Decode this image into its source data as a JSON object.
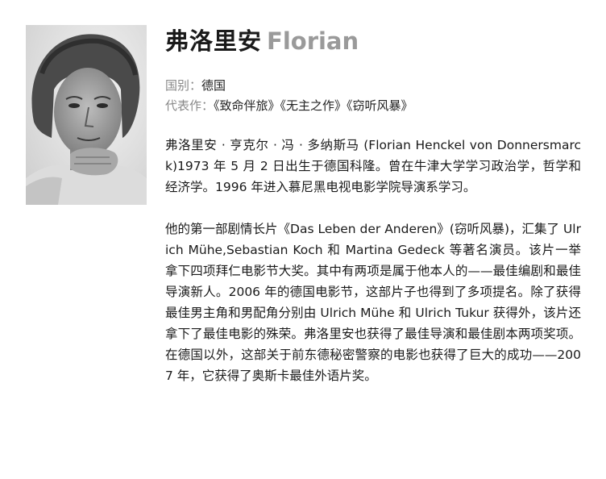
{
  "profile": {
    "name_zh": "弗洛里安",
    "name_en": "Florian",
    "nationality_label": "国别：",
    "nationality": "德国",
    "works_label": "代表作：",
    "works": "《致命伴旅》《无主之作》《窃听风暴》"
  },
  "bio": {
    "paragraphs": [
      "弗洛里安 · 亨克尔 · 冯 · 多纳斯马 (Florian Henckel von Donnersmarck)1973 年 5 月 2 日出生于德国科隆。曾在牛津大学学习政治学，哲学和经济学。1996 年进入慕尼黑电视电影学院导演系学习。",
      "他的第一部剧情长片《Das Leben der Anderen》(窃听风暴)，汇集了 Ulrich Mühe,Sebastian Koch 和 Martina Gedeck 等著名演员。该片一举拿下四项拜仁电影节大奖。其中有两项是属于他本人的——最佳编剧和最佳导演新人。2006 年的德国电影节，这部片子也得到了多项提名。除了获得最佳男主角和男配角分别由 Ulrich Mühe 和 Ulrich Tukur 获得外，该片还拿下了最佳电影的殊荣。弗洛里安也获得了最佳导演和最佳剧本两项奖项。在德国以外，这部关于前东德秘密警察的电影也获得了巨大的成功——2007 年，它获得了奥斯卡最佳外语片奖。"
    ]
  },
  "colors": {
    "name_en": "#9a9a9a",
    "label": "#888888",
    "text": "#1a1a1a"
  }
}
